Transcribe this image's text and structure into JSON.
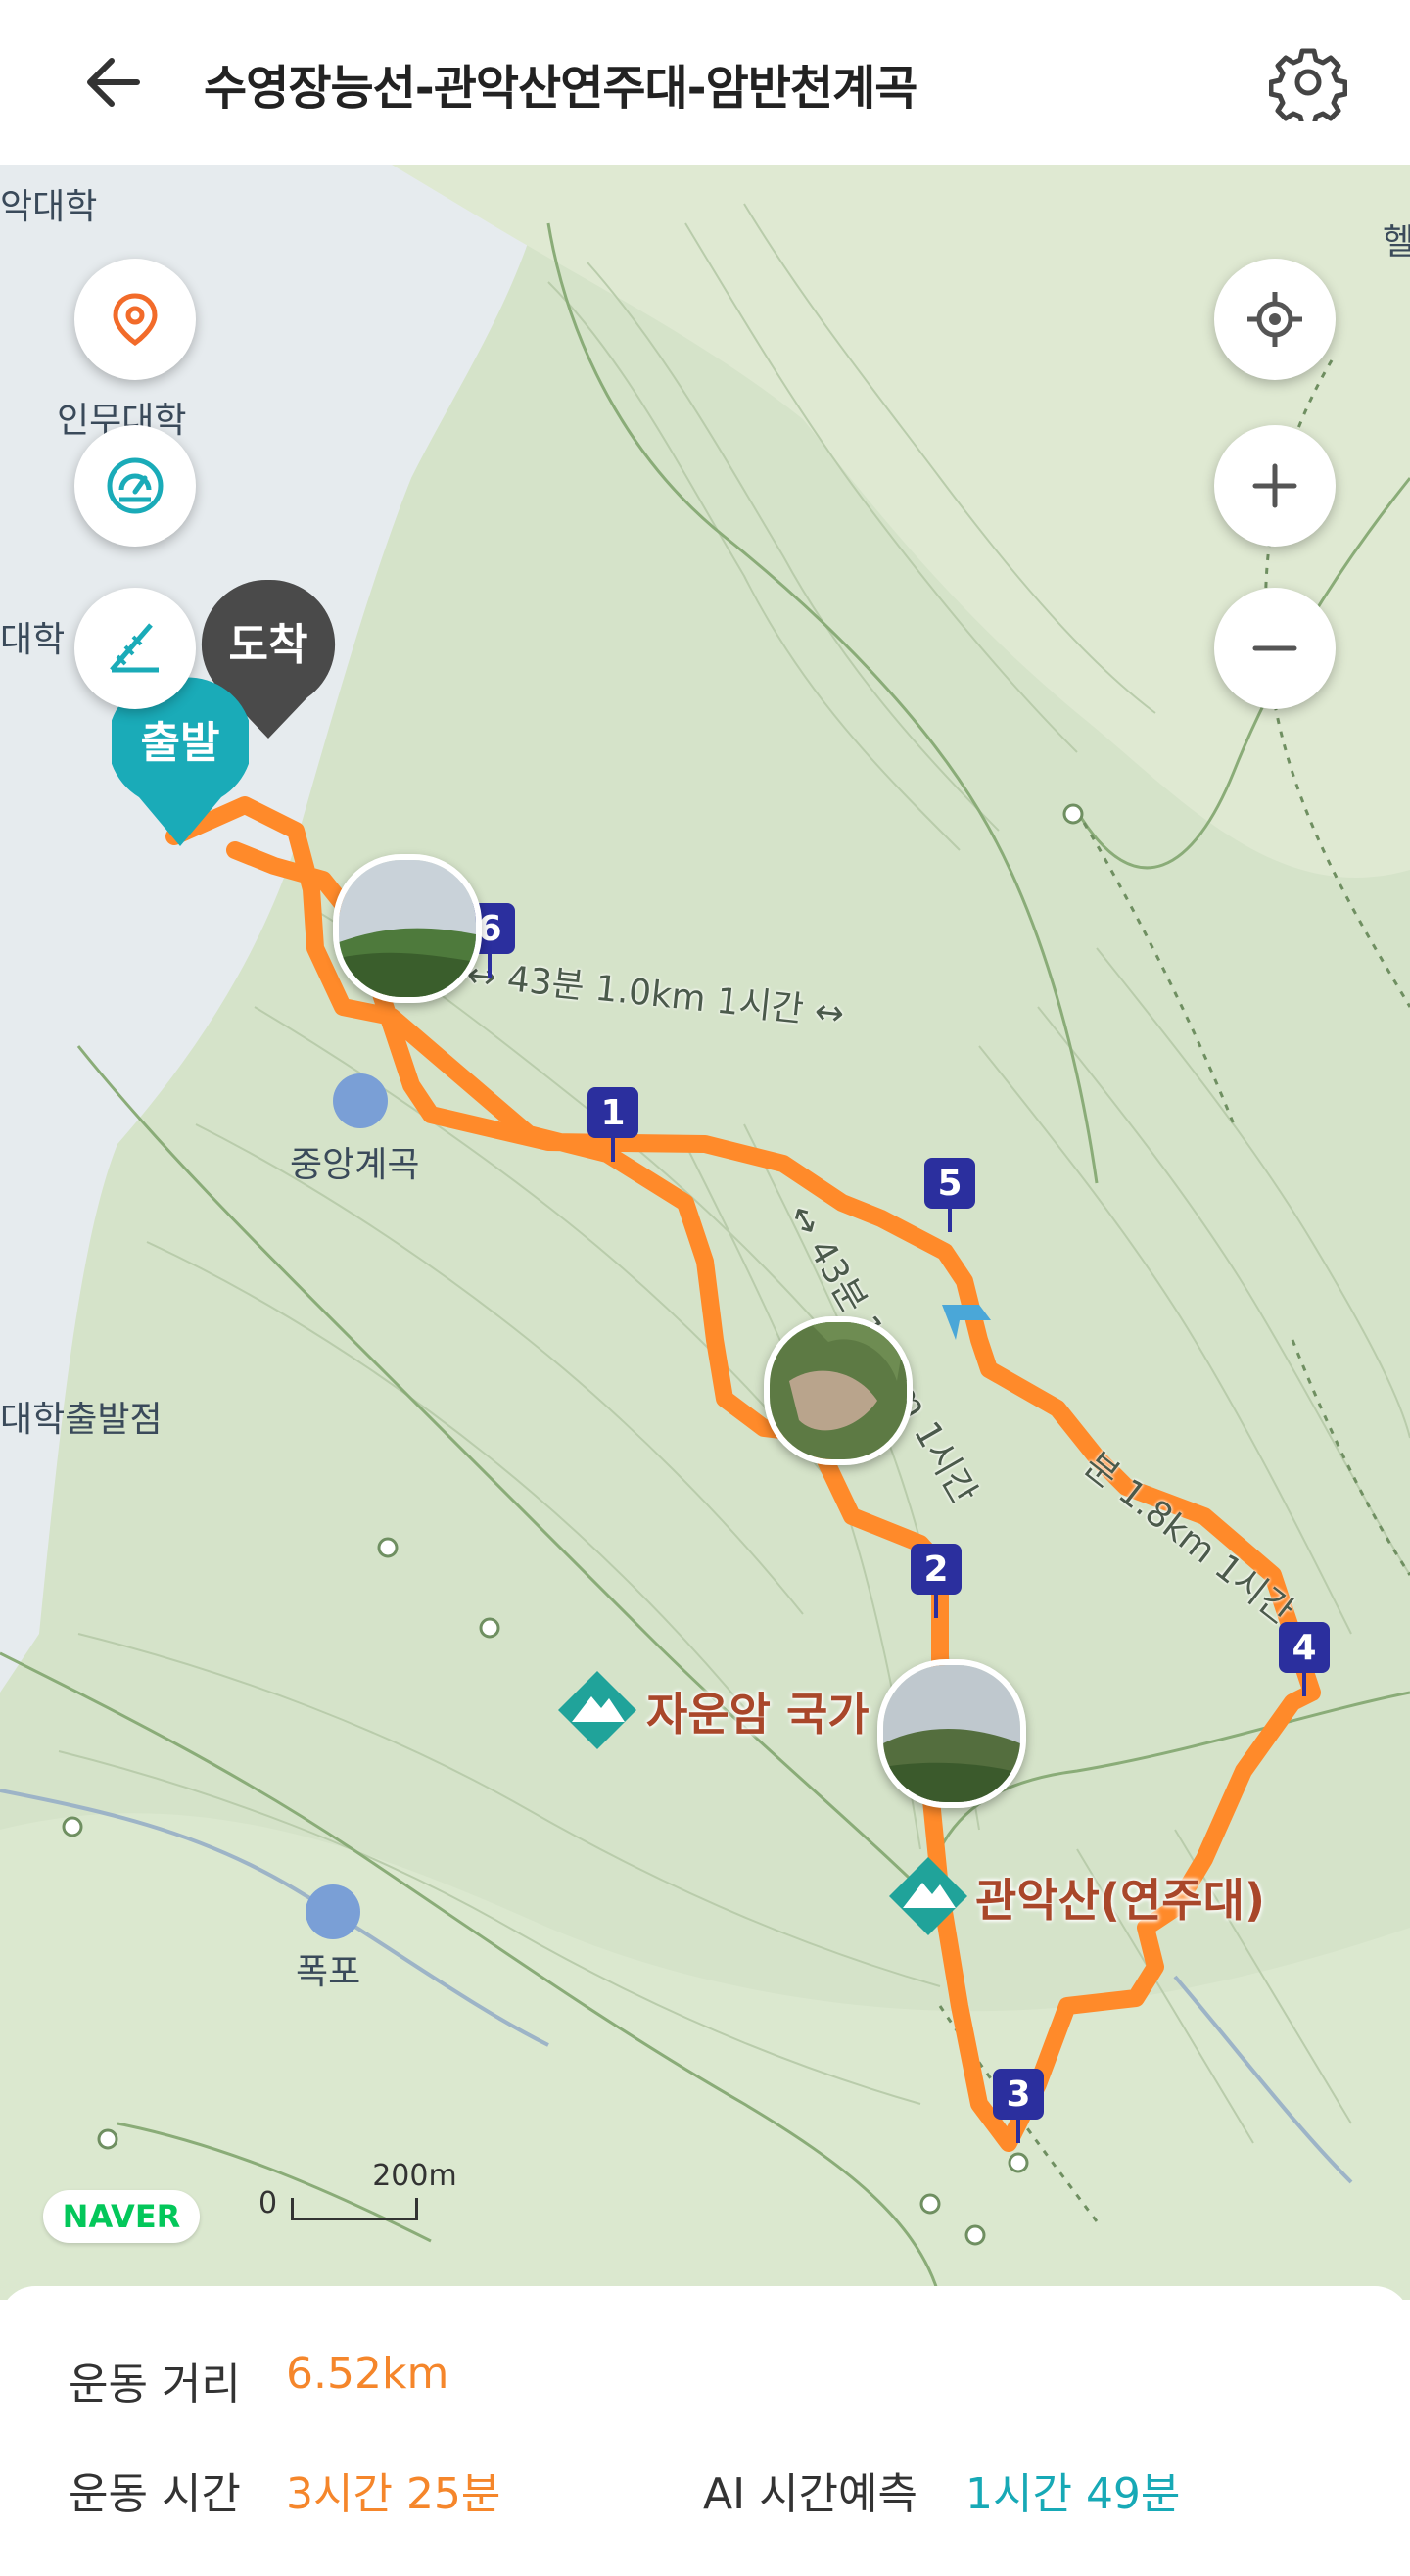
{
  "header": {
    "title": "수영장능선-관악산연주대-암반천계곡",
    "back_icon": "arrow-left-icon",
    "settings_icon": "gear-icon"
  },
  "map": {
    "labels": {
      "top_left_1": "악대학",
      "top_left_2": "인무대학",
      "left_mid": "대학",
      "right_top": "헬",
      "valley": "중앙계곡",
      "stop": "대학출발점",
      "waterfall": "폭포",
      "peak_jaun": "자운암 국가",
      "peak_gwanak": "관악산(연주대)"
    },
    "trail_labels": {
      "seg_a": "↔ 43분 1.0km 1시간 ↔",
      "seg_b": "↔ 43분 1.8km 1시간",
      "seg_c": "분 1.8km 1시간"
    },
    "pins": {
      "start": "출발",
      "end": "도착"
    },
    "markers": [
      "1",
      "2",
      "3",
      "4",
      "5",
      "6"
    ],
    "brand": "NAVER",
    "scale_zero": "0",
    "scale_value": "200m",
    "controls": {
      "location_icon": "location-pin-icon",
      "speedometer_icon": "speedometer-icon",
      "measure_icon": "ruler-measure-icon",
      "gps_icon": "gps-target-icon",
      "zoom_in_icon": "plus-icon",
      "zoom_out_icon": "minus-icon"
    },
    "route_color": "#ff8a2a"
  },
  "stats": {
    "distance_label": "운동 거리",
    "distance_value": "6.52km",
    "time_label": "운동 시간",
    "time_value": "3시간 25분",
    "ai_label": "AI 시간예측",
    "ai_value": "1시간 49분"
  },
  "colors": {
    "orange": "#f5862b",
    "teal": "#17a9b6",
    "marker_blue": "#2b2f9e",
    "pin_dark": "#4a4a4a",
    "pin_teal": "#1aabb8"
  }
}
